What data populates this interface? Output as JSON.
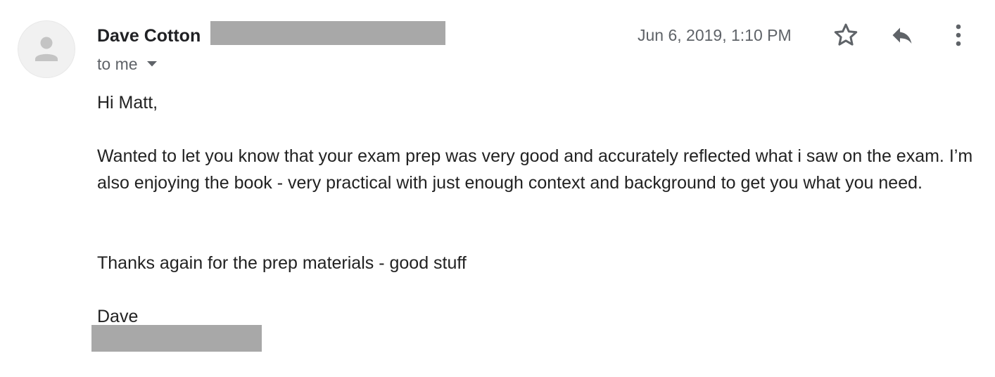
{
  "sender": {
    "name": "Dave Cotton",
    "avatar_icon": "person-icon"
  },
  "recipient": {
    "label": "to me",
    "caret_icon": "caret-down-icon"
  },
  "timestamp": "Jun 6, 2019, 1:10 PM",
  "actions": {
    "star_icon": "star-outline-icon",
    "reply_icon": "reply-icon",
    "more_icon": "more-vertical-icon"
  },
  "message": {
    "greeting": "Hi Matt,",
    "paragraph": "Wanted to let you know that your exam prep was very good and accurately reflected what i saw on the exam.   I’m also enjoying the book - very practical with just enough context and background to get you what you need.",
    "thanks": "Thanks again for the prep materials - good stuff",
    "signoff": "Dave"
  },
  "colors": {
    "redaction": "#a8a8a8",
    "secondary_text": "#5f6368",
    "icon": "#5f6368"
  }
}
